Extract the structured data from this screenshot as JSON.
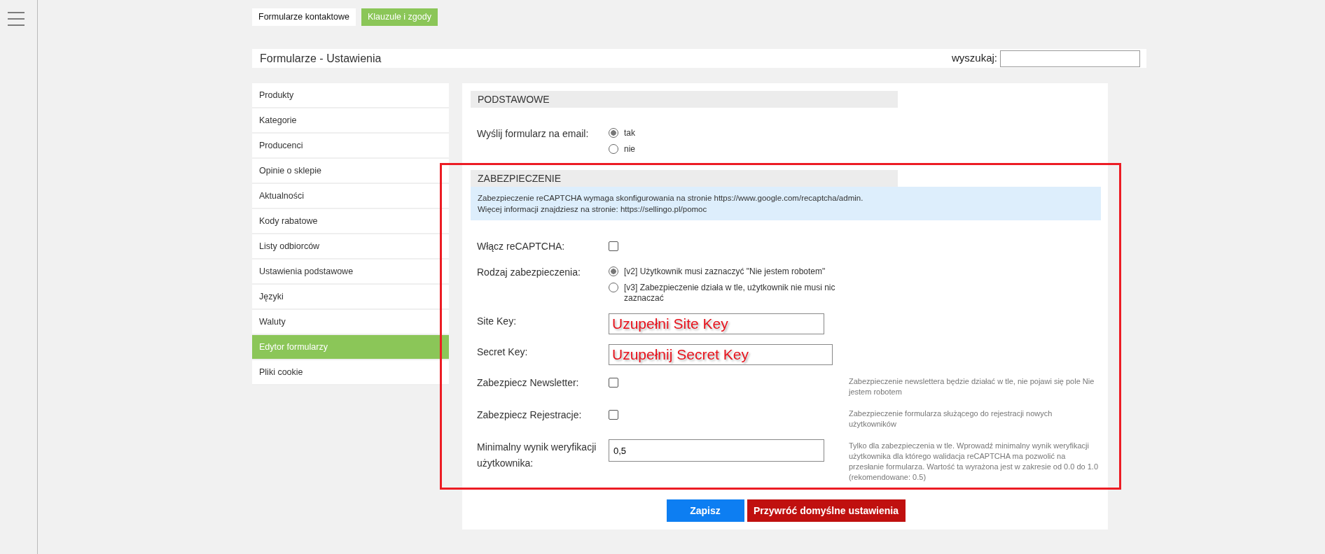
{
  "top_tabs": [
    {
      "label": "Formularze kontaktowe",
      "selected": false
    },
    {
      "label": "Klauzule i zgody",
      "selected": true
    }
  ],
  "header": {
    "title": "Formularze - Ustawienia",
    "search_label": "wyszukaj:"
  },
  "sidebar": {
    "items": [
      {
        "label": "Produkty",
        "selected": false
      },
      {
        "label": "Kategorie",
        "selected": false
      },
      {
        "label": "Producenci",
        "selected": false
      },
      {
        "label": "Opinie o sklepie",
        "selected": false
      },
      {
        "label": "Aktualności",
        "selected": false
      },
      {
        "label": "Kody rabatowe",
        "selected": false
      },
      {
        "label": "Listy odbiorców",
        "selected": false
      },
      {
        "label": "Ustawienia podstawowe",
        "selected": false
      },
      {
        "label": "Języki",
        "selected": false
      },
      {
        "label": "Waluty",
        "selected": false
      },
      {
        "label": "Edytor formularzy",
        "selected": true
      },
      {
        "label": "Pliki cookie",
        "selected": false
      }
    ]
  },
  "sections": [
    {
      "title": "PODSTAWOWE",
      "highlighted": false,
      "rows": [
        {
          "kind": "radio",
          "label": "Wyślij formularz na email:",
          "options": [
            {
              "label": "tak",
              "selected": true
            },
            {
              "label": "nie",
              "selected": false
            }
          ]
        }
      ]
    },
    {
      "title": "ZABEZPIECZENIE",
      "highlighted": true,
      "info": [
        "Zabezpieczenie reCAPTCHA wymaga skonfigurowania na stronie https://www.google.com/recaptcha/admin.",
        "Więcej informacji znajdziesz na stronie: https://sellingo.pl/pomoc"
      ],
      "rows": [
        {
          "kind": "checkbox",
          "label": "Włącz reCAPTCHA:",
          "checked": false
        },
        {
          "kind": "radio",
          "label": "Rodzaj zabezpieczenia:",
          "options": [
            {
              "label": "[v2] Użytkownik musi zaznaczyć \"Nie jestem robotem\"",
              "selected": true
            },
            {
              "label": "[v3] Zabezpieczenie działa w tle, użytkownik nie musi nic zaznaczać",
              "selected": false
            }
          ]
        },
        {
          "kind": "text",
          "label": "Site Key:",
          "value": "Uzupełni Site Key",
          "emphasis": true
        },
        {
          "kind": "text",
          "label": "Secret Key:",
          "value": "Uzupełnij Secret Key",
          "emphasis": true
        },
        {
          "kind": "checkbox",
          "label": "Zabezpiecz Newsletter:",
          "checked": false,
          "note": "Zabezpieczenie newslettera będzie działać w tle, nie pojawi się pole Nie jestem robotem"
        },
        {
          "kind": "checkbox",
          "label": "Zabezpiecz Rejestracje:",
          "checked": false,
          "note": "Zabezpieczenie formularza służącego do rejestracji nowych użytkowników"
        },
        {
          "kind": "text",
          "label": "Minimalny wynik weryfikacji użytkownika:",
          "value": "0,5",
          "emphasis": false,
          "note": "Tylko dla zabezpieczenia w tle. Wprowadź minimalny wynik weryfikacji użytkownika dla którego walidacja reCAPTCHA ma pozwolić na przesłanie formularza. Wartość ta wyrażona jest w zakresie od 0.0 do 1.0 (rekomendowane: 0.5)"
        }
      ]
    }
  ],
  "buttons": [
    {
      "label": "Zapisz",
      "kind": "primary"
    },
    {
      "label": "Przywróć domyślne ustawienia",
      "kind": "danger"
    }
  ]
}
